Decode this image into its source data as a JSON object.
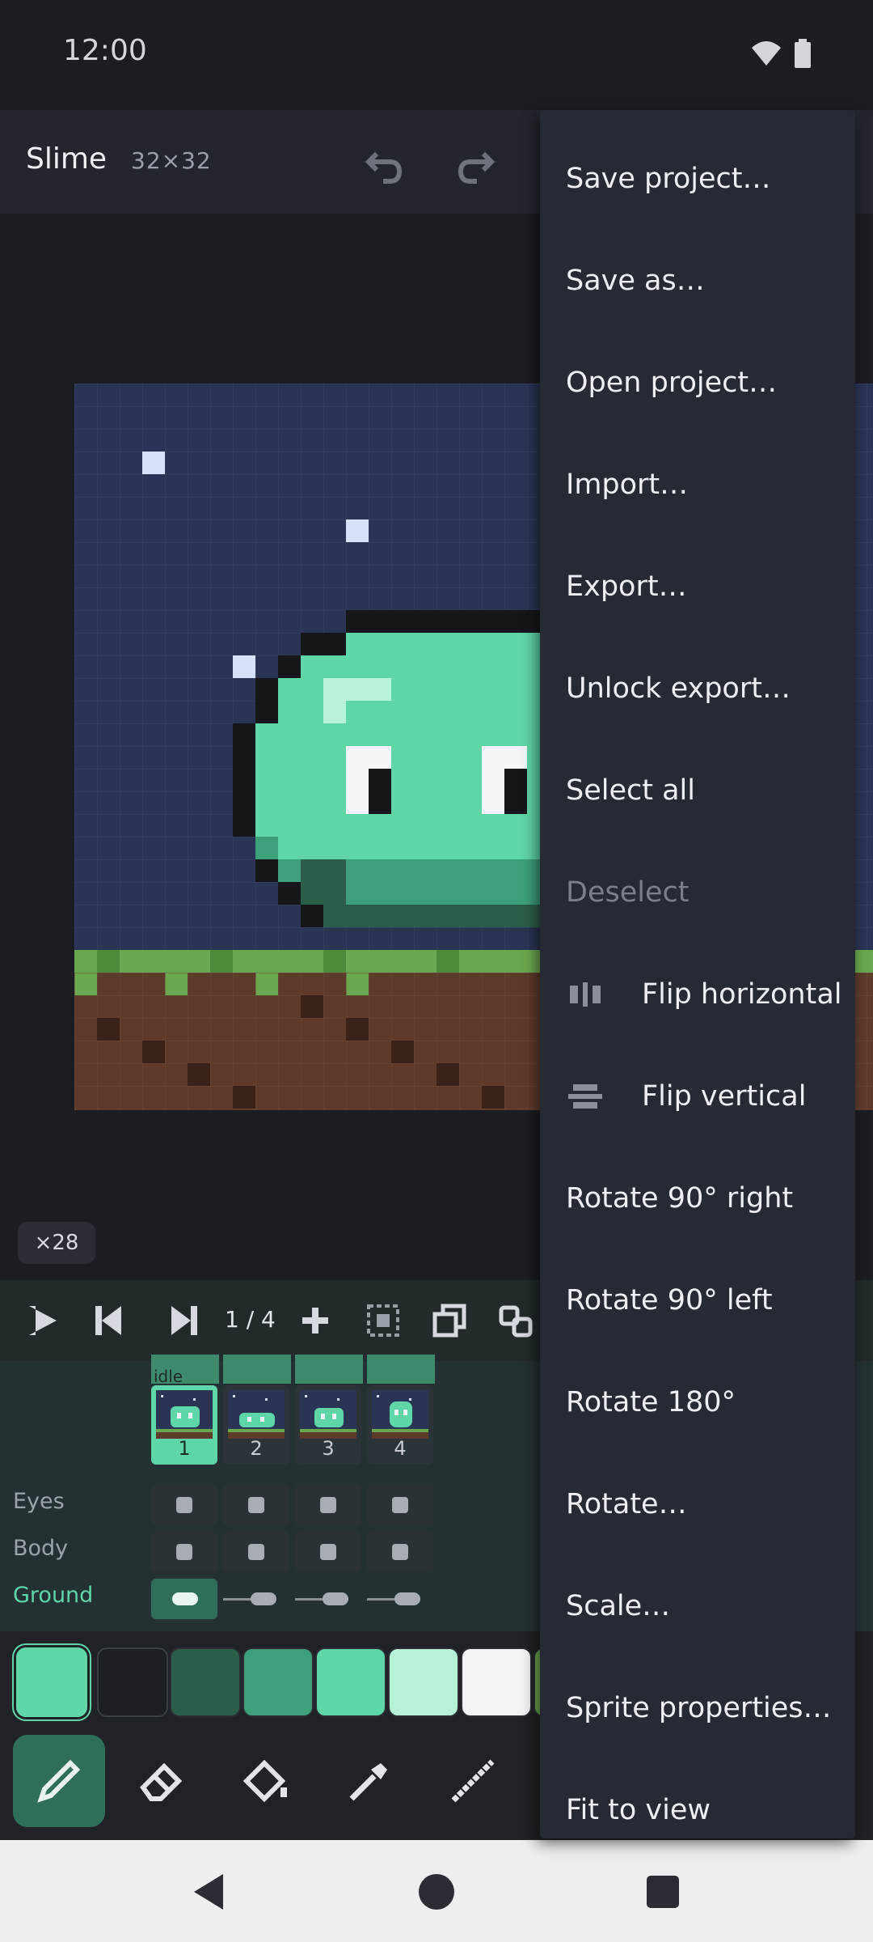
{
  "status": {
    "time": "12:00"
  },
  "header": {
    "title": "Slime",
    "size": "32×32"
  },
  "canvas": {
    "zoom": "×28"
  },
  "timeline": {
    "frame_counter": "1 / 4",
    "tag_label": "idle",
    "frames": [
      "1",
      "2",
      "3",
      "4"
    ],
    "selected_frame": 1,
    "layers": [
      "Eyes",
      "Body",
      "Ground"
    ],
    "active_layer": "Ground"
  },
  "palette": {
    "colors": [
      "#5fd6a8",
      "#1c1f24",
      "#2b5e48",
      "#3ea07a",
      "#5fd6a8",
      "#b6f2d8",
      "#f1f4f6",
      "#6aa84f"
    ],
    "selected_index": 0
  },
  "tools": [
    "pencil",
    "eraser",
    "fill-bucket",
    "eyedropper",
    "line"
  ],
  "menu": {
    "items": [
      {
        "label": "Save project…",
        "enabled": true
      },
      {
        "label": "Save as…",
        "enabled": true
      },
      {
        "label": "Open project…",
        "enabled": true
      },
      {
        "label": "Import…",
        "enabled": true
      },
      {
        "label": "Export…",
        "enabled": true
      },
      {
        "label": "Unlock export…",
        "enabled": true
      },
      {
        "label": "Select all",
        "enabled": true
      },
      {
        "label": "Deselect",
        "enabled": false
      },
      {
        "label": "Flip horizontal",
        "enabled": true,
        "icon": "flip-horizontal-icon"
      },
      {
        "label": "Flip vertical",
        "enabled": true,
        "icon": "flip-vertical-icon"
      },
      {
        "label": "Rotate 90° right",
        "enabled": true
      },
      {
        "label": "Rotate 90° left",
        "enabled": true
      },
      {
        "label": "Rotate 180°",
        "enabled": true
      },
      {
        "label": "Rotate…",
        "enabled": true
      },
      {
        "label": "Scale…",
        "enabled": true
      },
      {
        "label": "Sprite properties…",
        "enabled": true
      },
      {
        "label": "Fit to view",
        "enabled": true
      }
    ]
  }
}
